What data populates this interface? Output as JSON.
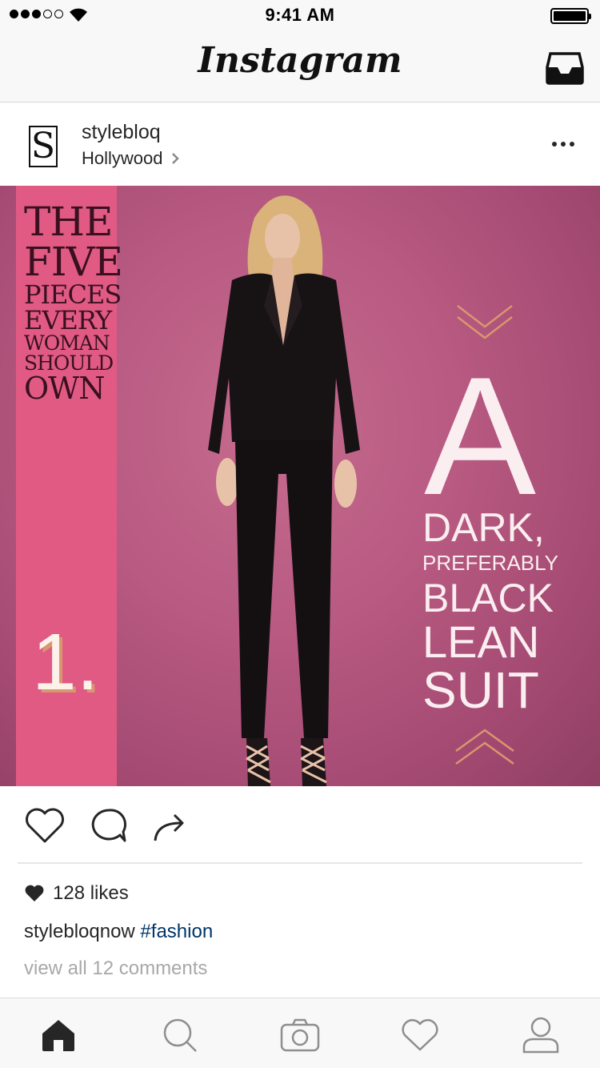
{
  "status_bar": {
    "time": "9:41 AM"
  },
  "header": {
    "title": "Instagram"
  },
  "post": {
    "avatar_letter": "S",
    "username": "stylebloq",
    "location": "Hollywood",
    "image": {
      "title_lines": [
        "THE",
        "FIVE",
        "PIECES",
        "EVERY",
        "WOMAN",
        "SHOULD",
        "OWN"
      ],
      "number": "1.",
      "big_letter": "A",
      "suit_lines": [
        "DARK,",
        "PREFERABLY",
        "BLACK",
        "LEAN",
        "SUIT"
      ]
    },
    "likes": "128 likes",
    "caption_user": "stylebloqnow",
    "caption_tag": "#fashion",
    "comments_link": "view all 12 comments"
  },
  "tabs": [
    "home",
    "search",
    "camera",
    "activity",
    "profile"
  ],
  "colors": {
    "accent_band": "#e05a84",
    "photo_bg": "#b85a82",
    "hashtag": "#003569",
    "chevron": "#d9966f"
  }
}
